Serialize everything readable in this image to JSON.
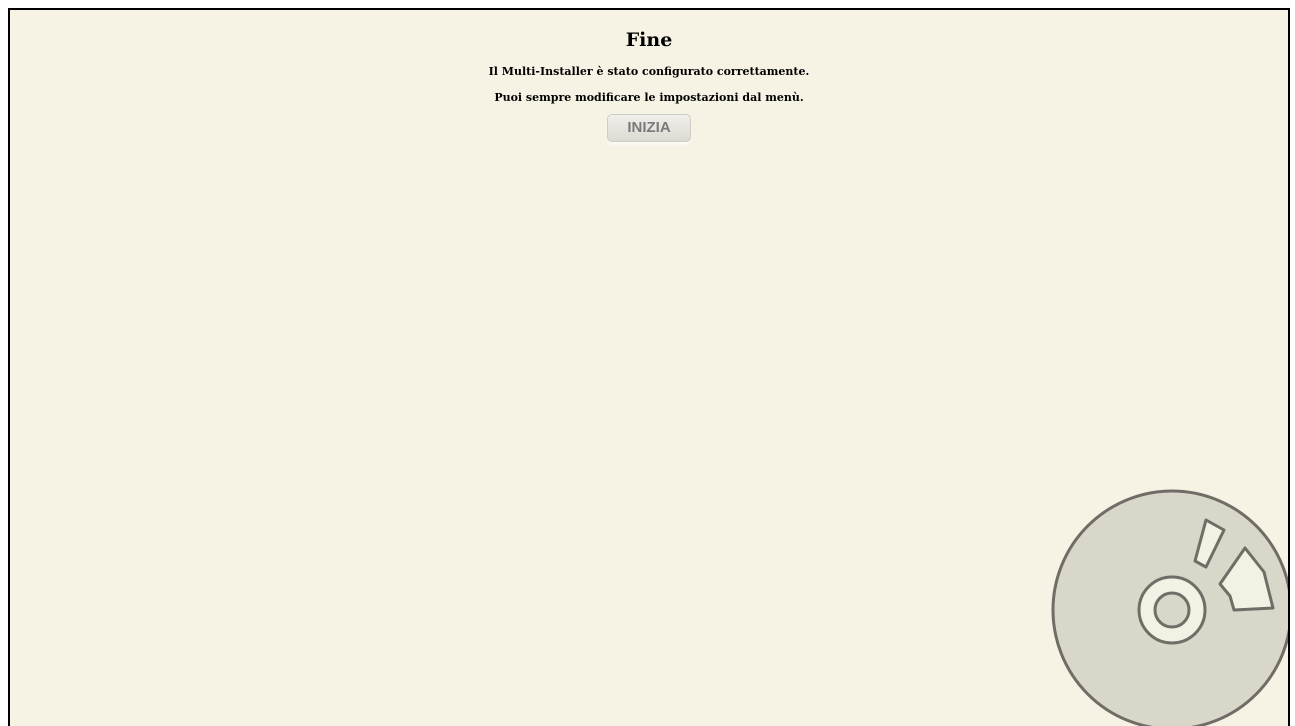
{
  "page": {
    "title": "Fine",
    "message_1": "Il Multi-Installer è stato configurato correttamente.",
    "message_2": "Puoi sempre modificare le impostazioni dal menù."
  },
  "actions": {
    "start_label": "INIZIA"
  },
  "decoration": {
    "icon": "disc-icon"
  },
  "colors": {
    "background": "#f6f3e5",
    "button_text": "#7a7a7a",
    "disc_fill": "#d9d6ca",
    "disc_stroke": "#6f6d66"
  }
}
